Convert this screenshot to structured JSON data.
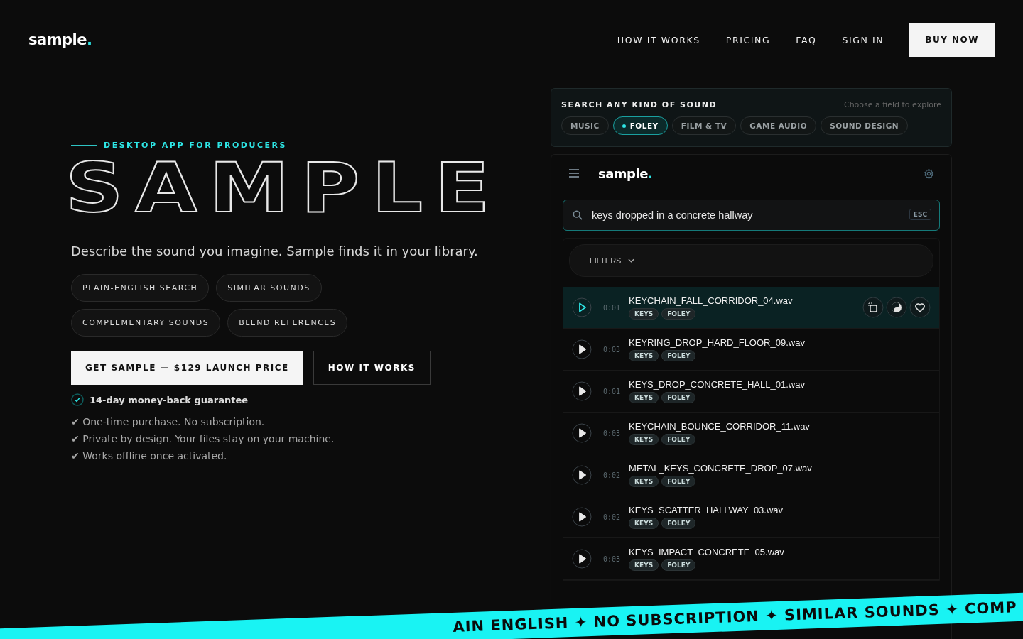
{
  "nav": {
    "logo": "sample",
    "logo_dot": ".",
    "links": [
      "HOW IT WORKS",
      "PRICING",
      "FAQ",
      "SIGN IN"
    ],
    "cta": "BUY NOW"
  },
  "hero": {
    "eyebrow": "DESKTOP APP FOR PRODUCERS",
    "title": "SAMPLE",
    "subtitle": "Describe the sound you imagine. Sample finds it in your library.",
    "features": [
      "PLAIN-ENGLISH SEARCH",
      "SIMILAR SOUNDS",
      "COMPLEMENTARY SOUNDS",
      "BLEND REFERENCES"
    ],
    "primary_button": "GET SAMPLE — $129 LAUNCH PRICE",
    "secondary_button": "HOW IT WORKS",
    "guarantee": "14-day money-back guarantee",
    "points": [
      "✔ One-time purchase. No subscription.",
      "✔ Private by design. Your files stay on your machine.",
      "✔ Works offline once activated."
    ]
  },
  "search_panel": {
    "title": "SEARCH ANY KIND OF SOUND",
    "hint": "Choose a field to explore",
    "fields": [
      {
        "label": "MUSIC",
        "selected": false
      },
      {
        "label": "FOLEY",
        "selected": true
      },
      {
        "label": "FILM & TV",
        "selected": false
      },
      {
        "label": "GAME AUDIO",
        "selected": false
      },
      {
        "label": "SOUND DESIGN",
        "selected": false
      }
    ]
  },
  "app": {
    "logo": "sample",
    "logo_dot": ".",
    "search": {
      "value": "keys dropped in a concrete hallway",
      "key": "ESC"
    },
    "filters": "FILTERS",
    "results": [
      {
        "name": "KEYCHAIN_FALL_CORRIDOR_04.wav",
        "duration": "0:01",
        "tags": [
          "KEYS",
          "FOLEY"
        ],
        "selected": true
      },
      {
        "name": "KEYRING_DROP_HARD_FLOOR_09.wav",
        "duration": "0:03",
        "tags": [
          "KEYS",
          "FOLEY"
        ],
        "selected": false
      },
      {
        "name": "KEYS_DROP_CONCRETE_HALL_01.wav",
        "duration": "0:01",
        "tags": [
          "KEYS",
          "FOLEY"
        ],
        "selected": false
      },
      {
        "name": "KEYCHAIN_BOUNCE_CORRIDOR_11.wav",
        "duration": "0:03",
        "tags": [
          "KEYS",
          "FOLEY"
        ],
        "selected": false
      },
      {
        "name": "METAL_KEYS_CONCRETE_DROP_07.wav",
        "duration": "0:02",
        "tags": [
          "KEYS",
          "FOLEY"
        ],
        "selected": false
      },
      {
        "name": "KEYS_SCATTER_HALLWAY_03.wav",
        "duration": "0:02",
        "tags": [
          "KEYS",
          "FOLEY"
        ],
        "selected": false
      },
      {
        "name": "KEYS_IMPACT_CONCRETE_05.wav",
        "duration": "0:03",
        "tags": [
          "KEYS",
          "FOLEY"
        ],
        "selected": false
      }
    ]
  },
  "ticker": "AIN ENGLISH ✦ NO SUBSCRIPTION ✦ SIMILAR SOUNDS ✦ COMP"
}
